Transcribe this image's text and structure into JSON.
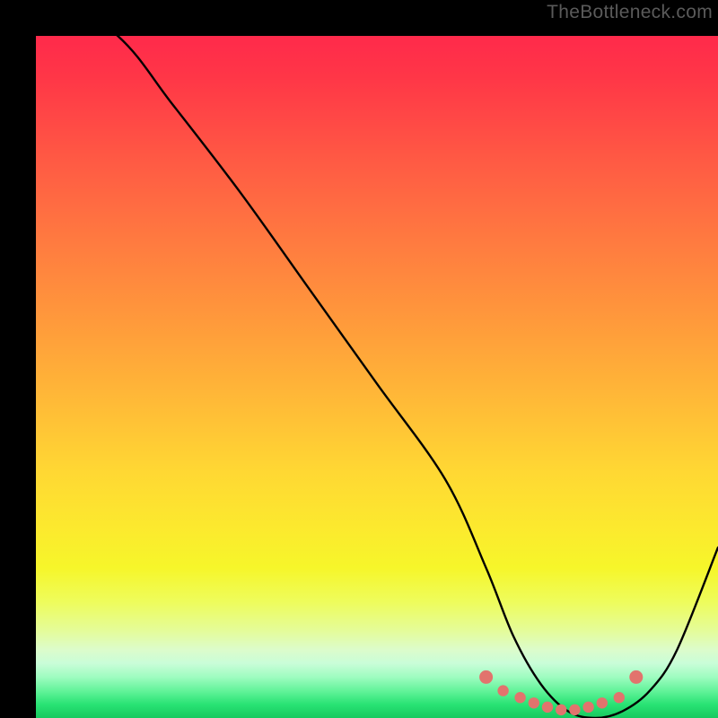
{
  "watermark": "TheBottleneck.com",
  "chart_data": {
    "type": "line",
    "title": "",
    "xlabel": "",
    "ylabel": "",
    "xlim": [
      0,
      100
    ],
    "ylim": [
      0,
      100
    ],
    "grid": false,
    "series": [
      {
        "name": "bottleneck-curve",
        "x": [
          0,
          12,
          20,
          30,
          40,
          50,
          60,
          66,
          70,
          74,
          78,
          82,
          86,
          90,
          94,
          100
        ],
        "values": [
          108,
          100,
          90,
          77,
          63,
          49,
          35,
          22,
          12,
          5,
          1,
          0,
          1,
          4,
          10,
          25
        ]
      }
    ],
    "marker_points": {
      "name": "optimal-range-markers",
      "x": [
        66.0,
        68.5,
        71.0,
        73.0,
        75.0,
        77.0,
        79.0,
        81.0,
        83.0,
        85.5,
        88.0
      ],
      "values": [
        6.0,
        4.0,
        3.0,
        2.2,
        1.6,
        1.2,
        1.2,
        1.6,
        2.2,
        3.0,
        6.0
      ]
    },
    "background_gradient": {
      "top_color": "#ff2a4b",
      "mid_color": "#fce92e",
      "bottom_color": "#17c95f"
    }
  }
}
